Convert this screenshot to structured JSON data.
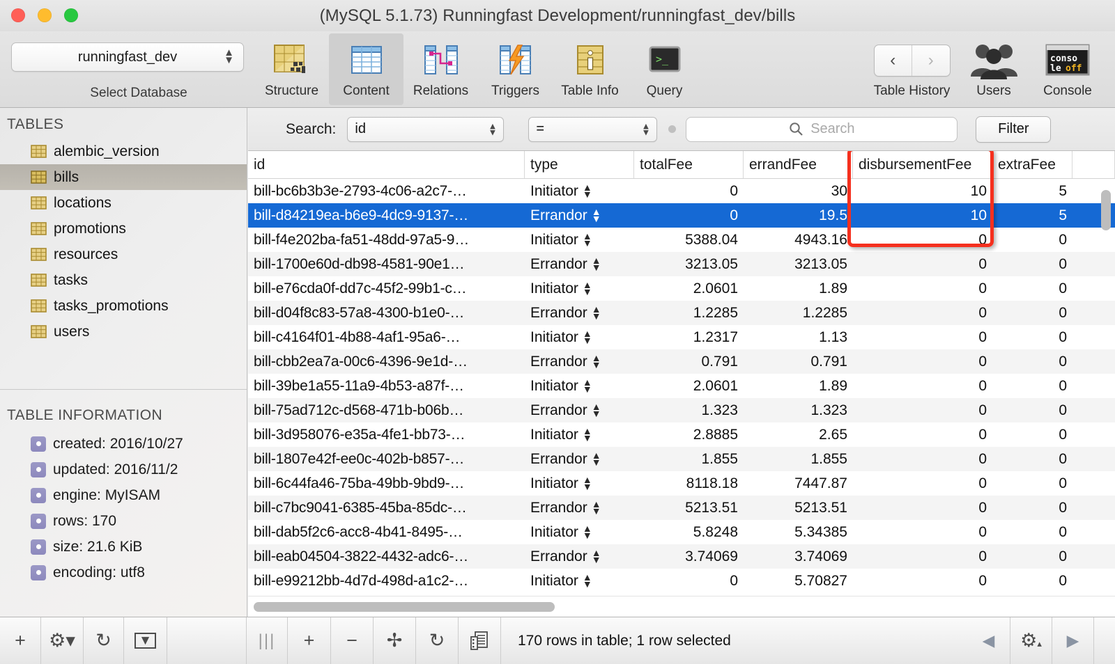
{
  "window": {
    "title": "(MySQL 5.1.73) Runningfast Development/runningfast_dev/bills",
    "traffic_lights": [
      "close-button",
      "minimize-button",
      "zoom-button"
    ]
  },
  "toolbar": {
    "database_select": {
      "value": "runningfast_dev",
      "label": "Select Database"
    },
    "items": [
      {
        "label": "Structure",
        "icon": "structure-icon",
        "active": false
      },
      {
        "label": "Content",
        "icon": "content-icon",
        "active": true
      },
      {
        "label": "Relations",
        "icon": "relations-icon",
        "active": false
      },
      {
        "label": "Triggers",
        "icon": "triggers-icon",
        "active": false
      },
      {
        "label": "Table Info",
        "icon": "table-info-icon",
        "active": false
      },
      {
        "label": "Query",
        "icon": "query-icon",
        "active": false
      }
    ],
    "right_items": [
      {
        "label": "Table History",
        "icon": "history-nav-icon"
      },
      {
        "label": "Users",
        "icon": "users-icon"
      },
      {
        "label": "Console",
        "icon": "console-icon",
        "badge": "console off"
      }
    ]
  },
  "sidebar": {
    "tables_header": "TABLES",
    "tables": [
      {
        "name": "alembic_version",
        "selected": false
      },
      {
        "name": "bills",
        "selected": true
      },
      {
        "name": "locations",
        "selected": false
      },
      {
        "name": "promotions",
        "selected": false
      },
      {
        "name": "resources",
        "selected": false
      },
      {
        "name": "tasks",
        "selected": false
      },
      {
        "name": "tasks_promotions",
        "selected": false
      },
      {
        "name": "users",
        "selected": false
      }
    ],
    "info_header": "TABLE INFORMATION",
    "info": [
      "created: 2016/10/27",
      "updated: 2016/11/2",
      "engine: MyISAM",
      "rows: 170",
      "size: 21.6 KiB",
      "encoding: utf8"
    ]
  },
  "filterbar": {
    "search_label": "Search:",
    "field_value": "id",
    "operator_value": "=",
    "search_placeholder": "Search",
    "filter_button": "Filter"
  },
  "grid": {
    "columns": [
      "id",
      "type",
      "totalFee",
      "errandFee",
      "disbursementFee",
      "extraFee"
    ],
    "highlighted_column": "disbursementFee",
    "highlight_color": "#f5301e",
    "selection_color": "#1569d4",
    "rows": [
      {
        "id": "bill-bc6b3b3e-2793-4c06-a2c7-…",
        "type": "Initiator",
        "totalFee": "0",
        "errandFee": "30",
        "disbursementFee": "10",
        "extraFee": "5",
        "selected": false
      },
      {
        "id": "bill-d84219ea-b6e9-4dc9-9137-…",
        "type": "Errandor",
        "totalFee": "0",
        "errandFee": "19.5",
        "disbursementFee": "10",
        "extraFee": "5",
        "selected": true
      },
      {
        "id": "bill-f4e202ba-fa51-48dd-97a5-9…",
        "type": "Initiator",
        "totalFee": "5388.04",
        "errandFee": "4943.16",
        "disbursementFee": "0",
        "extraFee": "0",
        "selected": false
      },
      {
        "id": "bill-1700e60d-db98-4581-90e1…",
        "type": "Errandor",
        "totalFee": "3213.05",
        "errandFee": "3213.05",
        "disbursementFee": "0",
        "extraFee": "0",
        "selected": false
      },
      {
        "id": "bill-e76cda0f-dd7c-45f2-99b1-c…",
        "type": "Initiator",
        "totalFee": "2.0601",
        "errandFee": "1.89",
        "disbursementFee": "0",
        "extraFee": "0",
        "selected": false
      },
      {
        "id": "bill-d04f8c83-57a8-4300-b1e0-…",
        "type": "Errandor",
        "totalFee": "1.2285",
        "errandFee": "1.2285",
        "disbursementFee": "0",
        "extraFee": "0",
        "selected": false
      },
      {
        "id": "bill-c4164f01-4b88-4af1-95a6-…",
        "type": "Initiator",
        "totalFee": "1.2317",
        "errandFee": "1.13",
        "disbursementFee": "0",
        "extraFee": "0",
        "selected": false
      },
      {
        "id": "bill-cbb2ea7a-00c6-4396-9e1d-…",
        "type": "Errandor",
        "totalFee": "0.791",
        "errandFee": "0.791",
        "disbursementFee": "0",
        "extraFee": "0",
        "selected": false
      },
      {
        "id": "bill-39be1a55-11a9-4b53-a87f-…",
        "type": "Initiator",
        "totalFee": "2.0601",
        "errandFee": "1.89",
        "disbursementFee": "0",
        "extraFee": "0",
        "selected": false
      },
      {
        "id": "bill-75ad712c-d568-471b-b06b…",
        "type": "Errandor",
        "totalFee": "1.323",
        "errandFee": "1.323",
        "disbursementFee": "0",
        "extraFee": "0",
        "selected": false
      },
      {
        "id": "bill-3d958076-e35a-4fe1-bb73-…",
        "type": "Initiator",
        "totalFee": "2.8885",
        "errandFee": "2.65",
        "disbursementFee": "0",
        "extraFee": "0",
        "selected": false
      },
      {
        "id": "bill-1807e42f-ee0c-402b-b857-…",
        "type": "Errandor",
        "totalFee": "1.855",
        "errandFee": "1.855",
        "disbursementFee": "0",
        "extraFee": "0",
        "selected": false
      },
      {
        "id": "bill-6c44fa46-75ba-49bb-9bd9-…",
        "type": "Initiator",
        "totalFee": "8118.18",
        "errandFee": "7447.87",
        "disbursementFee": "0",
        "extraFee": "0",
        "selected": false
      },
      {
        "id": "bill-c7bc9041-6385-45ba-85dc-…",
        "type": "Errandor",
        "totalFee": "5213.51",
        "errandFee": "5213.51",
        "disbursementFee": "0",
        "extraFee": "0",
        "selected": false
      },
      {
        "id": "bill-dab5f2c6-acc8-4b41-8495-…",
        "type": "Initiator",
        "totalFee": "5.8248",
        "errandFee": "5.34385",
        "disbursementFee": "0",
        "extraFee": "0",
        "selected": false
      },
      {
        "id": "bill-eab04504-3822-4432-adc6-…",
        "type": "Errandor",
        "totalFee": "3.74069",
        "errandFee": "3.74069",
        "disbursementFee": "0",
        "extraFee": "0",
        "selected": false
      },
      {
        "id": "bill-e99212bb-4d7d-498d-a1c2-…",
        "type": "Initiator",
        "totalFee": "0",
        "errandFee": "5.70827",
        "disbursementFee": "0",
        "extraFee": "0",
        "selected": false
      }
    ]
  },
  "bottombar": {
    "status": "170 rows in table; 1 row selected",
    "left_buttons": [
      {
        "icon": "add-table-icon",
        "glyph": "+"
      },
      {
        "icon": "table-gear-icon",
        "glyph": "⚙"
      },
      {
        "icon": "refresh-tables-icon",
        "glyph": "↻"
      },
      {
        "icon": "filter-tables-icon",
        "glyph": "▼"
      }
    ],
    "row_buttons": [
      {
        "icon": "add-row-icon",
        "glyph": "+"
      },
      {
        "icon": "delete-row-icon",
        "glyph": "−"
      },
      {
        "icon": "duplicate-row-icon",
        "glyph": "✢"
      },
      {
        "icon": "refresh-rows-icon",
        "glyph": "↻"
      },
      {
        "icon": "view-row-icon",
        "glyph": "▤"
      }
    ],
    "right_buttons": [
      {
        "icon": "prev-page-icon",
        "glyph": "◀"
      },
      {
        "icon": "page-gear-icon",
        "glyph": "⚙"
      },
      {
        "icon": "next-page-icon",
        "glyph": "▶"
      }
    ],
    "resize_handle": "column-resize-handle"
  }
}
